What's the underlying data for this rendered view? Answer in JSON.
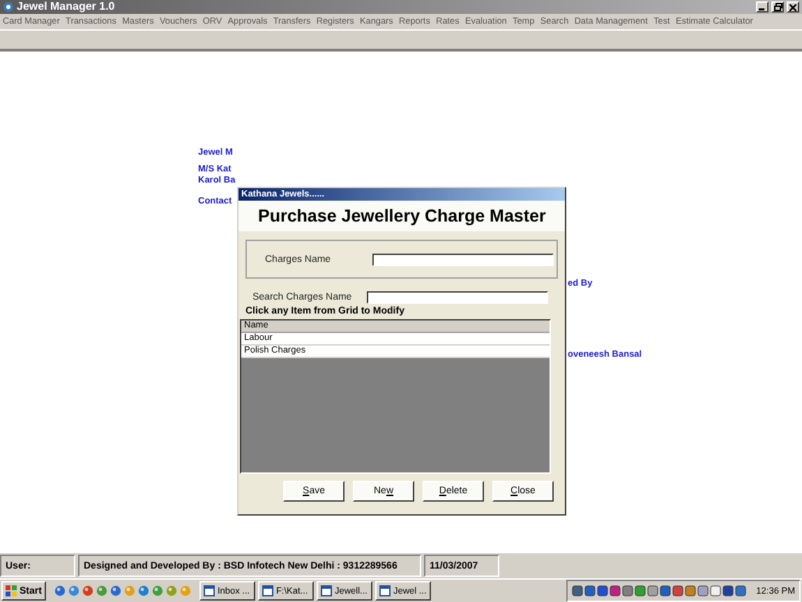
{
  "window": {
    "title": "Jewel Manager 1.0"
  },
  "menu": [
    "Card Manager",
    "Transactions",
    "Masters",
    "Vouchers",
    "ORV",
    "Approvals",
    "Transfers",
    "Registers",
    "Kangars",
    "Reports",
    "Rates",
    "Evaluation",
    "Temp",
    "Search",
    "Data Management",
    "Test",
    "Estimate Calculator"
  ],
  "background_texts": [
    "Jewel M",
    "M/S Kat",
    "Karol Ba",
    "Contact",
    "ed By",
    "oveneesh Bansal"
  ],
  "dialog": {
    "title": "Kathana Jewels......",
    "heading": "Purchase Jewellery Charge Master",
    "fields": [
      {
        "label": "Charges Name"
      },
      {
        "label": "Search Charges Name"
      }
    ],
    "hint": "Click any Item from Grid to Modify",
    "grid": {
      "column": "Name",
      "rows": [
        "Labour",
        "Polish Charges"
      ]
    },
    "buttons": [
      {
        "key": "S",
        "after": "ave"
      },
      {
        "before": "Ne",
        "key": "w"
      },
      {
        "key": "D",
        "after": "elete"
      },
      {
        "key": "C",
        "after": "lose"
      }
    ]
  },
  "status_bar": [
    "User:",
    "Designed and Developed By : BSD Infotech New Delhi : 9312289566",
    "11/03/2007"
  ],
  "taskbar": {
    "start": "Start",
    "tasks": [
      "Inbox ...",
      "F:\\Kat...",
      "Jewell...",
      "Jewel ..."
    ],
    "clock": "12:36 PM"
  }
}
